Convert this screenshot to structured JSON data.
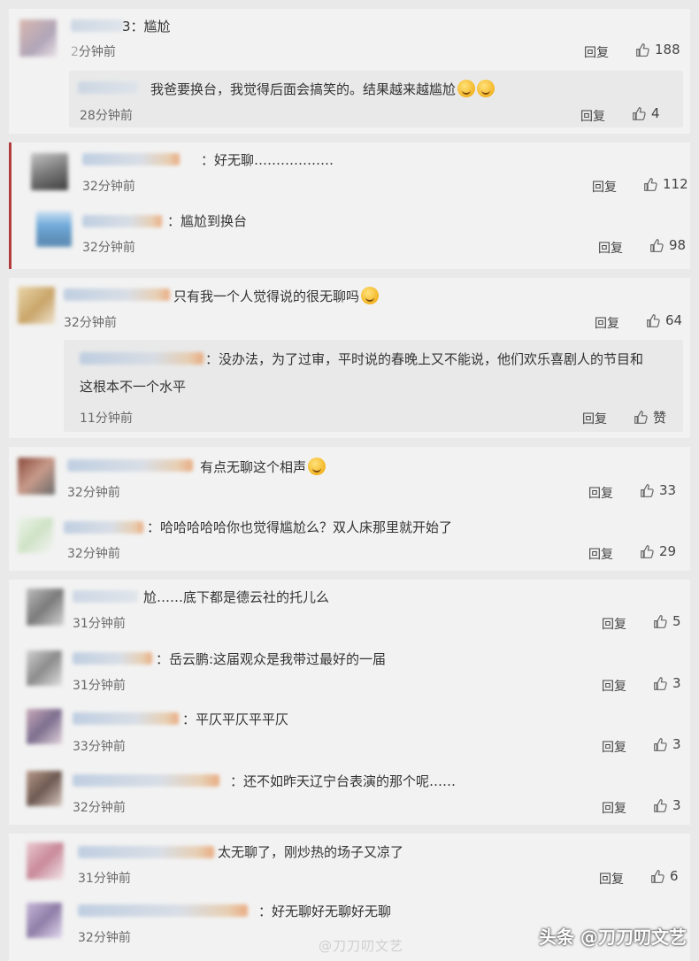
{
  "labels": {
    "reply": "回复"
  },
  "colors": {
    "card_bg": "#f2f2f2",
    "reply_bg": "#e9e9e9",
    "accent": "#b23b3b"
  },
  "threads": [
    {
      "comment": {
        "name_visible": "3",
        "text": "：尴尬",
        "time": "分钟前",
        "likes": "188"
      },
      "replies": [
        {
          "text": "我爸要换台，我觉得后面会搞笑的。结果越来越尴尬",
          "emoji": "grin-emoji",
          "time": "28分钟前",
          "likes": "4"
        }
      ]
    },
    {
      "comment": {
        "text": "：好无聊………………",
        "time": "32分钟前",
        "likes": "112"
      },
      "replies": [
        {
          "text": "：尴尬到换台",
          "time": "32分钟前",
          "likes": "98"
        }
      ]
    },
    {
      "comment": {
        "text": "只有我一个人觉得说的很无聊吗",
        "emoji": "laugh-emoji",
        "time": "32分钟前",
        "likes": "64"
      },
      "replies": [
        {
          "text": "：没办法，为了过审，平时说的春晚上又不能说，他们欢乐喜剧人的节目和",
          "text2": "这根本不一个水平",
          "time": "11分钟前",
          "likes": "赞"
        }
      ]
    },
    {
      "comment": {
        "text": "有点无聊这个相声",
        "emoji": "cry-laugh-emoji",
        "time": "32分钟前",
        "likes": "33"
      },
      "replies": [
        {
          "text": "：哈哈哈哈哈你也觉得尴尬么？双人床那里就开始了",
          "time": "32分钟前",
          "likes": "29"
        }
      ]
    },
    {
      "comment": {
        "text": "尬……底下都是德云社的托儿么",
        "time": "31分钟前",
        "likes": "5"
      },
      "replies": [
        {
          "text": "：岳云鹏:这届观众是我带过最好的一届",
          "time": "31分钟前",
          "likes": "3"
        },
        {
          "text": "：平仄平仄平平仄",
          "time": "33分钟前",
          "likes": "3"
        },
        {
          "text": "：还不如昨天辽宁台表演的那个呢……",
          "time": "32分钟前",
          "likes": "3"
        }
      ]
    },
    {
      "comment": {
        "text": "太无聊了，刚炒热的场子又凉了",
        "time": "31分钟前",
        "likes": "6"
      },
      "replies": [
        {
          "text": "：好无聊好无聊好无聊",
          "time": "32分钟前",
          "likes": ""
        }
      ]
    }
  ],
  "watermark": "@刀刀叨文艺",
  "brand": "头条 @刀刀叨文艺"
}
